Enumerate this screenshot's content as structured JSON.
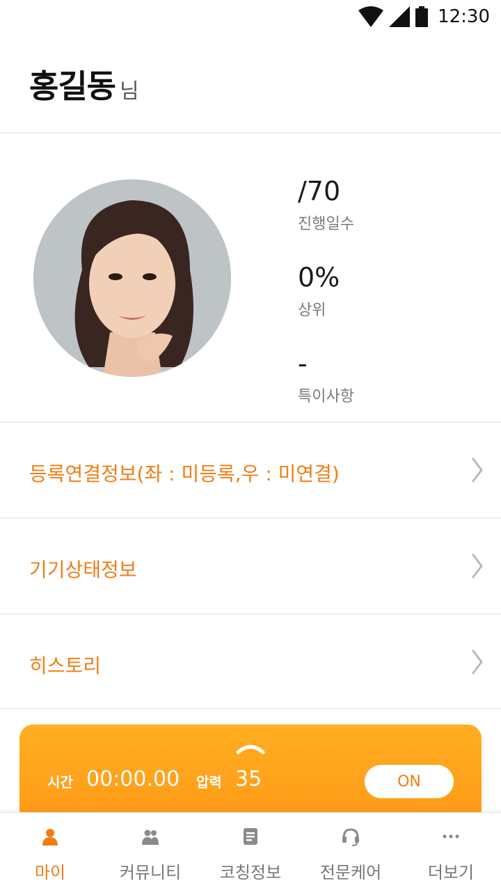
{
  "status_bar": {
    "time": "12:30",
    "icons": [
      "wifi-icon",
      "signal-icon",
      "battery-icon"
    ]
  },
  "header": {
    "name": "홍길동",
    "suffix": "님"
  },
  "profile": {
    "avatar": "avatar",
    "stats": [
      {
        "value": "/70",
        "label": "진행일수"
      },
      {
        "value": "0%",
        "label": "상위"
      },
      {
        "value": "-",
        "label": "특이사항"
      }
    ]
  },
  "menu": [
    {
      "label": "등록연결정보(좌 : 미등록,우 : 미연결)"
    },
    {
      "label": "기기상태정보"
    },
    {
      "label": "히스토리"
    }
  ],
  "control_panel": {
    "time_label": "시간",
    "time_value": "00:00.00",
    "pressure_label": "압력",
    "pressure_value": "35",
    "button_label": "ON"
  },
  "bottom_nav": [
    {
      "label": "마이",
      "icon": "person-icon",
      "active": true
    },
    {
      "label": "커뮤니티",
      "icon": "people-icon",
      "active": false
    },
    {
      "label": "코칭정보",
      "icon": "document-icon",
      "active": false
    },
    {
      "label": "전문케어",
      "icon": "headset-icon",
      "active": false
    },
    {
      "label": "더보기",
      "icon": "more-icon",
      "active": false
    }
  ],
  "colors": {
    "accent": "#f07d14",
    "panel_gradient_top": "#ffae22",
    "panel_gradient_bottom": "#ff9a17",
    "divider": "#eeeeee"
  }
}
